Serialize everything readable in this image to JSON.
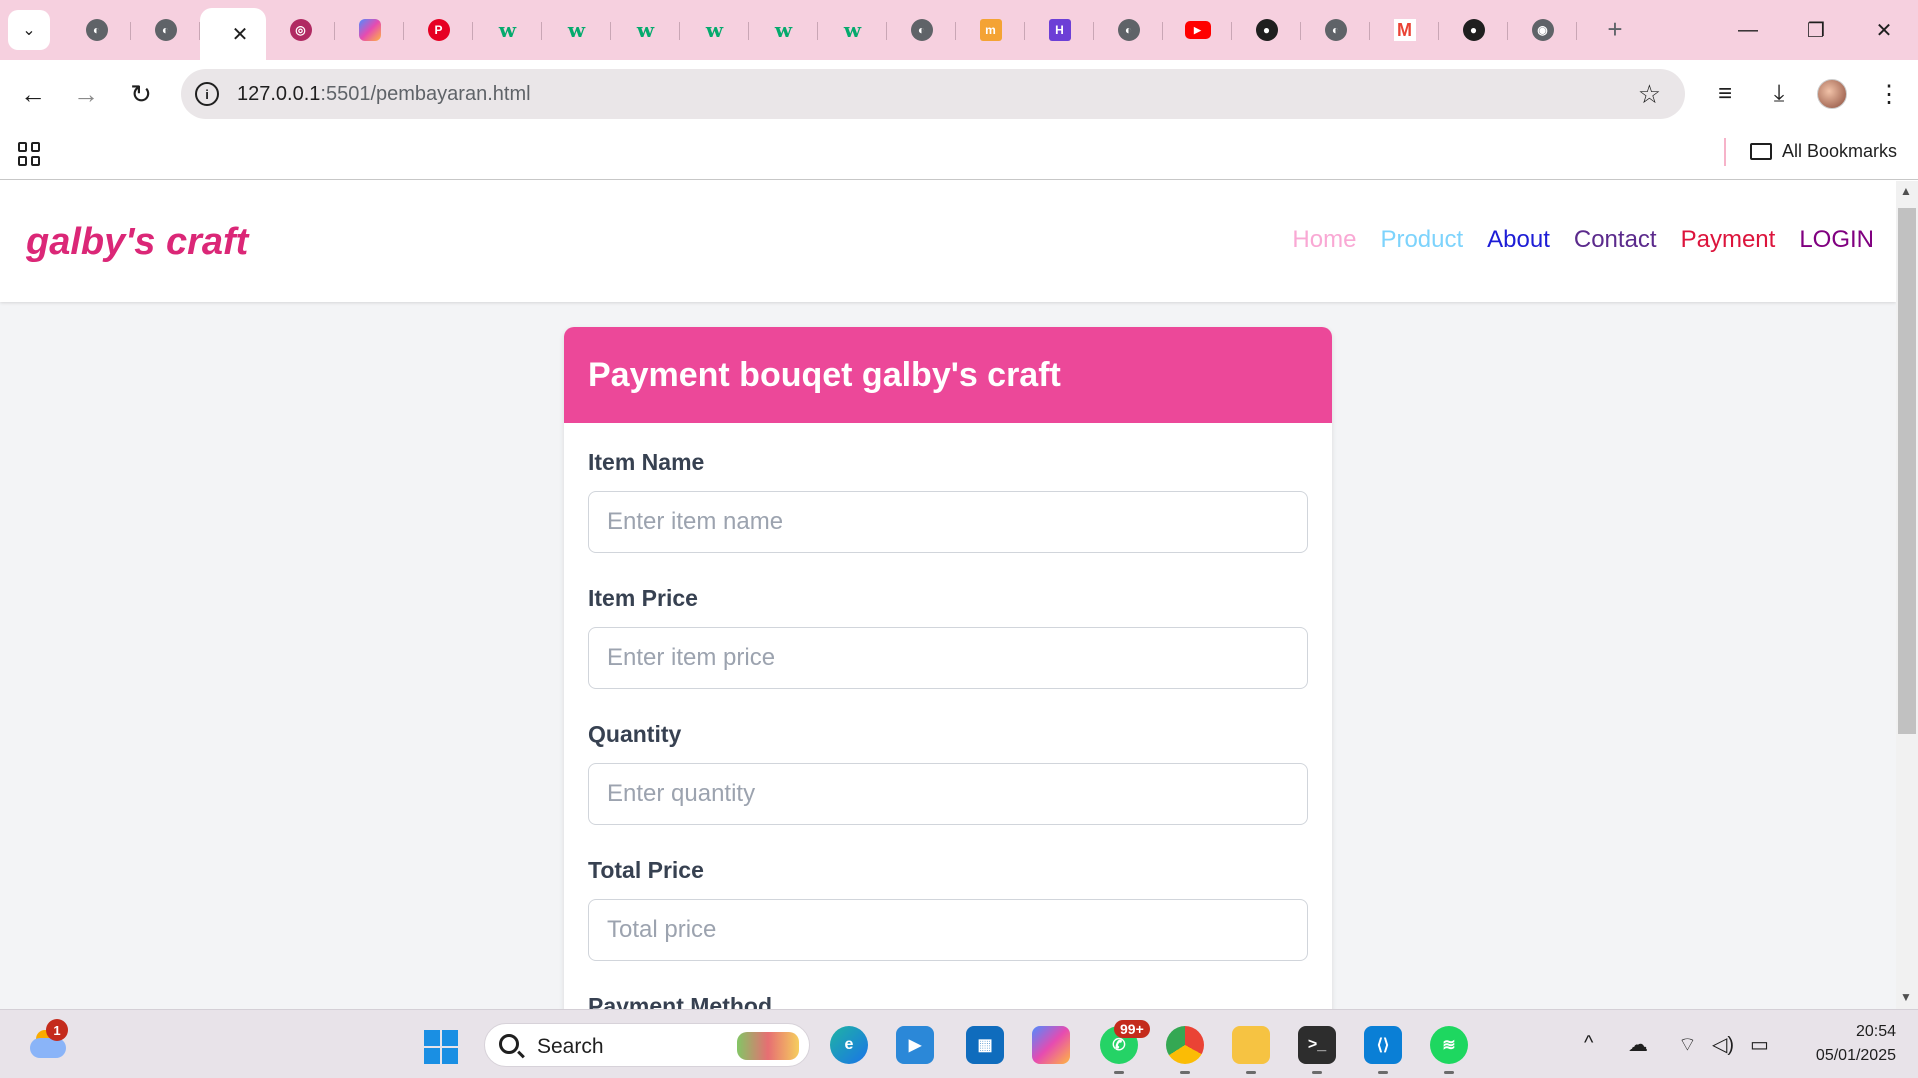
{
  "browser": {
    "active_tab_close": "✕",
    "new_tab": "+",
    "window": {
      "minimize": "—",
      "restore": "❐",
      "close": "✕"
    },
    "address": {
      "host": "127.0.0.1",
      "rest": ":5501/pembayaran.html"
    },
    "bookmarks_label": "All Bookmarks",
    "tab_favicons": [
      "globe-icon",
      "globe-icon",
      "active",
      "brain-icon",
      "copilot-icon",
      "pinterest-icon",
      "w3schools-icon",
      "w3schools-icon",
      "w3schools-icon",
      "w3schools-icon",
      "w3schools-icon",
      "w3schools-icon",
      "globe-icon",
      "moodle-icon",
      "h-icon",
      "globe-icon",
      "youtube-icon",
      "github-icon",
      "globe-icon",
      "gmail-icon",
      "github-icon",
      "chrome-icon"
    ]
  },
  "site": {
    "brand": "galby's craft",
    "nav": [
      {
        "label": "Home",
        "color": "#f9a8d4"
      },
      {
        "label": "Product",
        "color": "#7dd3fc"
      },
      {
        "label": "About",
        "color": "#1d1dd6"
      },
      {
        "label": "Contact",
        "color": "#5b2a8c"
      },
      {
        "label": "Payment",
        "color": "#dc143c"
      },
      {
        "label": "LOGIN",
        "color": "#800080"
      }
    ]
  },
  "card": {
    "title": "Payment bouqet galby's craft",
    "fields": [
      {
        "label": "Item Name",
        "placeholder": "Enter item name"
      },
      {
        "label": "Item Price",
        "placeholder": "Enter item price"
      },
      {
        "label": "Quantity",
        "placeholder": "Enter quantity"
      },
      {
        "label": "Total Price",
        "placeholder": "Total price"
      },
      {
        "label": "Payment Method",
        "placeholder": ""
      }
    ]
  },
  "taskbar": {
    "weather_badge": "1",
    "search_label": "Search",
    "whatsapp_badge": "99+",
    "time": "20:54",
    "date": "05/01/2025"
  },
  "colors": {
    "brand": "#db2777",
    "card_header": "#ec4899",
    "tab_strip": "#f6d0df"
  }
}
